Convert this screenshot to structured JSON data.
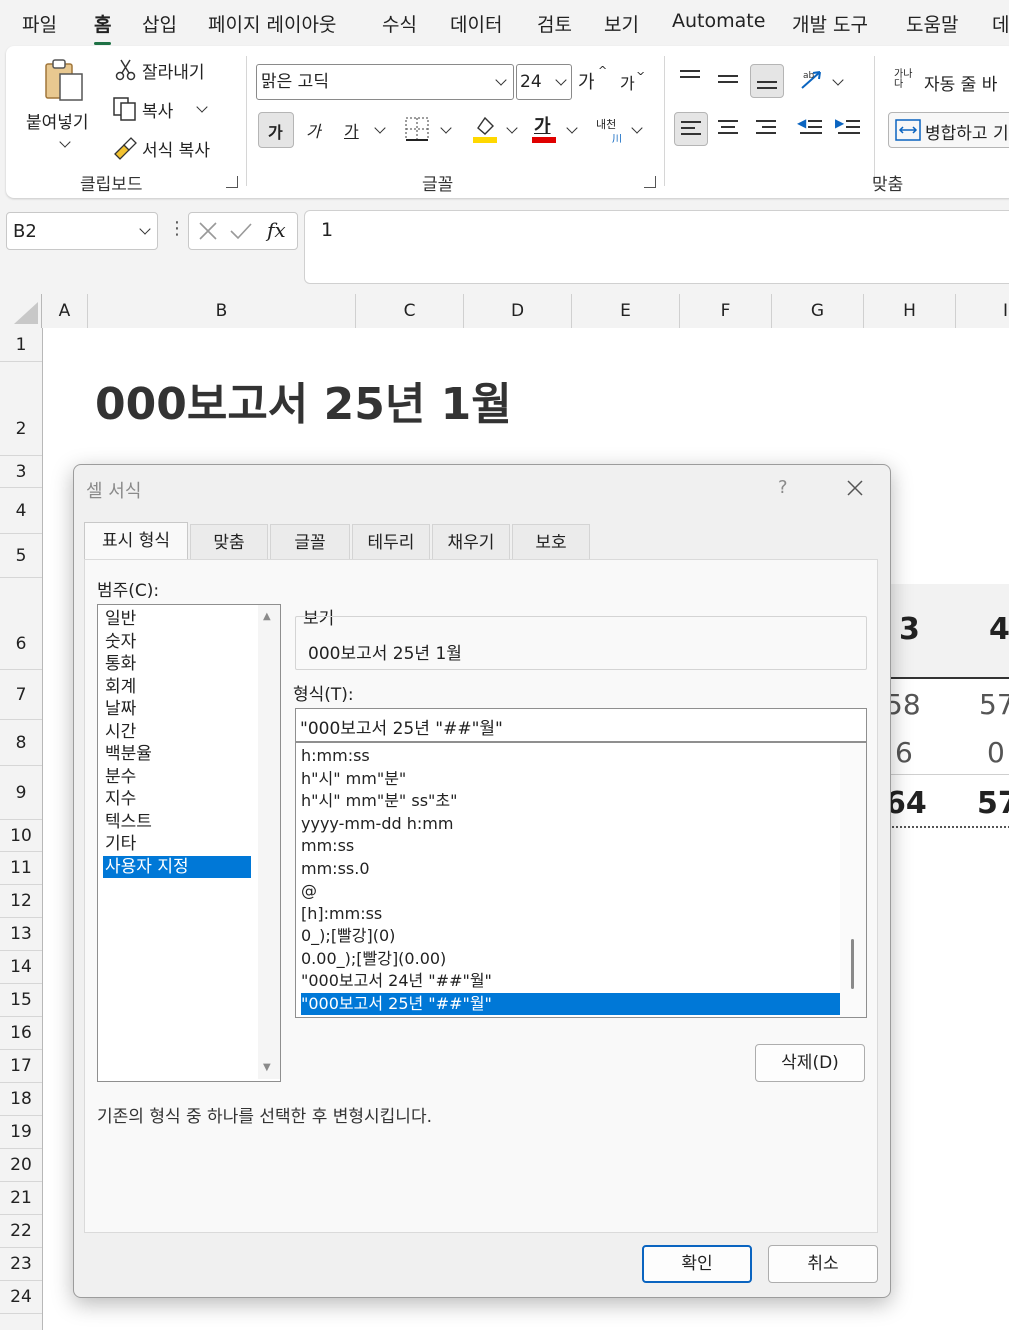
{
  "menu": {
    "tabs": [
      "파일",
      "홈",
      "삽입",
      "페이지 레이아웃",
      "수식",
      "데이터",
      "검토",
      "보기",
      "Automate",
      "개발 도구",
      "도움말",
      "데"
    ],
    "active": "홈"
  },
  "ribbon": {
    "clipboard": {
      "paste": "붙여넣기",
      "cut": "잘라내기",
      "copy": "복사",
      "format_painter": "서식 복사",
      "group": "클립보드"
    },
    "font": {
      "font_name": "맑은 고딕",
      "font_size": "24",
      "grow": "가",
      "shrink": "가",
      "bold": "가",
      "italic": "가",
      "underline": "가",
      "font_color_glyph": "가",
      "phonetic": "내천",
      "group": "글꼴",
      "highlight_color": "#ffd800",
      "font_color": "#e00000"
    },
    "alignment": {
      "wrap_text": "자동 줄 바",
      "merge": "병합하고 기",
      "wrap_icon_glyph": "가나다",
      "group": "맞춤"
    }
  },
  "formula_bar": {
    "name_box": "B2",
    "formula": "1"
  },
  "grid": {
    "columns": [
      "A",
      "B",
      "C",
      "D",
      "E",
      "F",
      "G",
      "H",
      "I"
    ],
    "rows": [
      "1",
      "2",
      "3",
      "4",
      "5",
      "6",
      "7",
      "8",
      "9",
      "10",
      "11",
      "12",
      "13",
      "14",
      "15",
      "16",
      "17",
      "18",
      "19",
      "20",
      "21",
      "22",
      "23",
      "24"
    ],
    "title": "000보고서 25년 1월",
    "visible_cells": {
      "h6": "3",
      "i6": "4",
      "h7": "58",
      "i7": "57",
      "h8": "6",
      "i8": "0",
      "h9": "64",
      "i9": "57"
    }
  },
  "dialog": {
    "title": "셀 서식",
    "help": "?",
    "tabs": [
      "표시 형식",
      "맞춤",
      "글꼴",
      "테두리",
      "채우기",
      "보호"
    ],
    "category_label": "범주(C):",
    "categories": [
      "일반",
      "숫자",
      "통화",
      "회계",
      "날짜",
      "시간",
      "백분율",
      "분수",
      "지수",
      "텍스트",
      "기타",
      "사용자 지정"
    ],
    "selected_category": "사용자 지정",
    "sample_label": "보기",
    "sample_value": "000보고서 25년 1월",
    "type_label": "형식(T):",
    "type_value": "\"000보고서 25년 \"##\"월\"",
    "formats": [
      "h:mm:ss",
      "h\"시\" mm\"분\"",
      "h\"시\" mm\"분\" ss\"초\"",
      "yyyy-mm-dd h:mm",
      "mm:ss",
      "mm:ss.0",
      "@",
      "[h]:mm:ss",
      "0_);[빨강](0)",
      "0.00_);[빨강](0.00)",
      "\"000보고서 24년 \"##\"월\"",
      "\"000보고서 25년 \"##\"월\""
    ],
    "selected_format": "\"000보고서 25년 \"##\"월\"",
    "delete_button": "삭제(D)",
    "hint": "기존의 형식 중 하나를 선택한 후 변형시킵니다.",
    "ok_button": "확인",
    "cancel_button": "취소"
  }
}
